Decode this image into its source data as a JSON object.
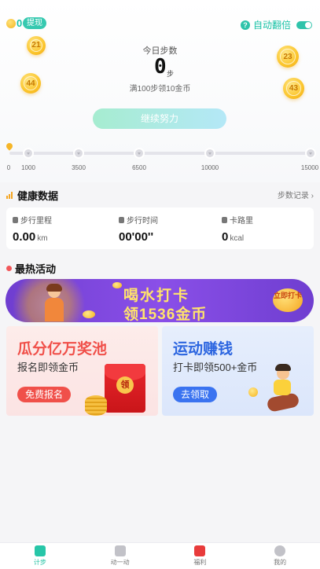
{
  "header": {
    "coin_count": "0",
    "withdraw_label": "提现",
    "auto_flip_label": "自动翻倍",
    "auto_flip_on": true
  },
  "bubbles": [
    "21",
    "23",
    "44",
    "43"
  ],
  "steps": {
    "label": "今日步数",
    "count": "0",
    "unit": "步",
    "rule": "满100步领10金币",
    "continue_label": "继续努力"
  },
  "progress": {
    "milestones": [
      "0",
      "1000",
      "3500",
      "6500",
      "10000",
      "15000"
    ],
    "current_steps": 0
  },
  "health": {
    "title": "健康数据",
    "record_link": "步数记录",
    "items": [
      {
        "label": "步行里程",
        "value": "0.00",
        "unit": "km",
        "icon": "footprint-icon"
      },
      {
        "label": "步行时间",
        "value": "00'00''",
        "unit": "",
        "icon": "walk-icon"
      },
      {
        "label": "卡路里",
        "value": "0",
        "unit": "kcal",
        "icon": "fire-icon"
      }
    ]
  },
  "hot": {
    "title": "最热活动",
    "banner": {
      "title": "喝水打卡",
      "subtitle": "领1536金币",
      "button": "立即打卡"
    },
    "cards": [
      {
        "title": "瓜分亿万奖池",
        "subtitle": "报名即领金币",
        "button": "免费报名",
        "seal": "领",
        "title_color": "#f0504a",
        "button_color": "#f0504a"
      },
      {
        "title": "运动赚钱",
        "subtitle": "打卡即领500+金币",
        "button": "去领取",
        "title_color": "#2d66e0",
        "button_color": "#3a73f0"
      }
    ]
  },
  "tabbar": {
    "tabs": [
      {
        "label": "计步",
        "active": true,
        "icon": "shoe-icon",
        "color": "#27c6a8"
      },
      {
        "label": "动一动",
        "active": false,
        "icon": "run-icon",
        "color": "#c2c2c8"
      },
      {
        "label": "福利",
        "active": false,
        "icon": "gift-icon",
        "color": "#e83b3b"
      },
      {
        "label": "我的",
        "active": false,
        "icon": "profile-icon",
        "color": "#c2c2c8"
      }
    ]
  },
  "colors": {
    "accent": "#27c6a8",
    "coin": "#f7b928"
  }
}
